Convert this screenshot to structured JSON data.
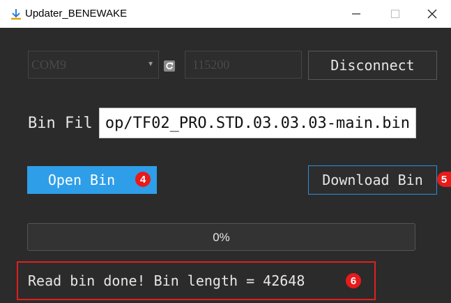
{
  "window": {
    "title": "Updater_BENEWAKE",
    "icon": "download-arrow-icon",
    "min_symbol": "—",
    "max_symbol": "☐",
    "close_symbol": "✕"
  },
  "serial": {
    "port_value": "COM9",
    "baud_value": "115200",
    "refresh_icon": "refresh-icon",
    "disconnect_label": "Disconnect"
  },
  "bin": {
    "label": "Bin Fil",
    "path_visible": "op/TF02_PRO.STD.03.03.03-main.bin"
  },
  "buttons": {
    "open_label": "Open Bin",
    "download_label": "Download Bin"
  },
  "annotations": {
    "n4": "4",
    "n5": "5",
    "n6": "6",
    "color": "#e81a1a"
  },
  "progress": {
    "value": 0,
    "text": "0%"
  },
  "status": {
    "message": "Read bin done! Bin length = 42648"
  },
  "colors": {
    "background": "#2b2b2b",
    "accent": "#2f9ee8",
    "text": "#e6e6e6"
  }
}
